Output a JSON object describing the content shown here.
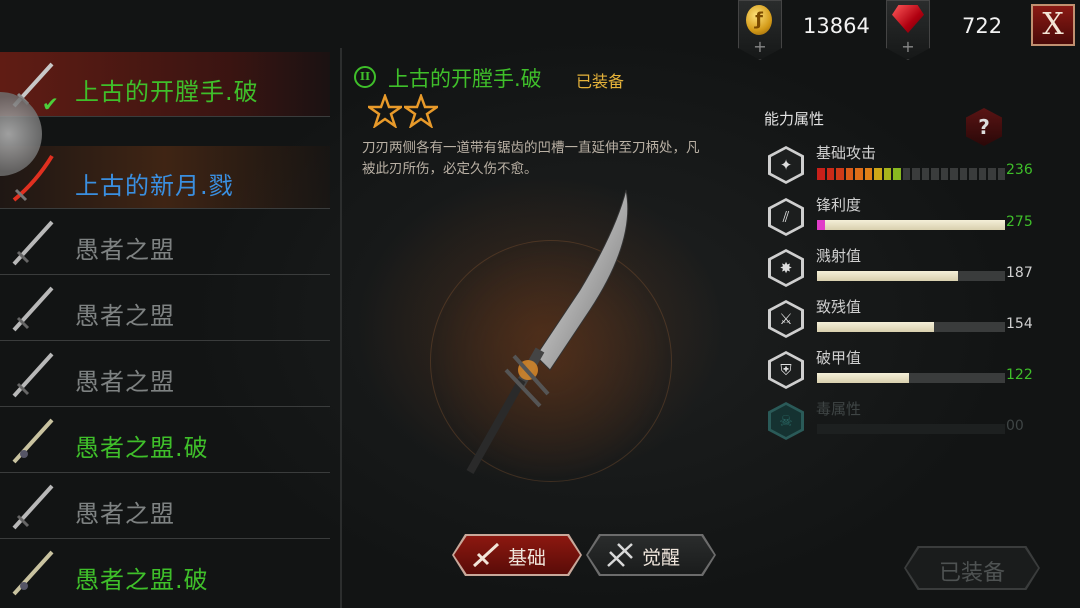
{
  "currency": {
    "gold_amount": "13864",
    "gem_amount": "722",
    "gold_icon": "gold-coin-icon",
    "gem_icon": "ruby-gem-icon",
    "plus_symbol": "+"
  },
  "close_label": "X",
  "weapon_list": [
    {
      "name": "上古的开膛手.破",
      "color": "#3fbf2a",
      "selected": true,
      "equipped": true
    },
    {
      "name": "上古的新月.戮",
      "color": "#3a8fe0"
    },
    {
      "name": "愚者之盟",
      "color": "#7e8282"
    },
    {
      "name": "愚者之盟",
      "color": "#7e8282"
    },
    {
      "name": "愚者之盟",
      "color": "#7e8282"
    },
    {
      "name": "愚者之盟.破",
      "color": "#3fbf2a"
    },
    {
      "name": "愚者之盟",
      "color": "#7e8282"
    },
    {
      "name": "愚者之盟.破",
      "color": "#3fbf2a"
    }
  ],
  "detail": {
    "tier": "II",
    "title": "上古的开膛手.破",
    "equipped_tag": "已装备",
    "stars": 2,
    "description": "刀刃两侧各有一道带有锯齿的凹槽一直延伸至刀柄处，凡被此刃所伤，必定久伤不愈。"
  },
  "attributes": {
    "title": "能力属性",
    "help_label": "?",
    "stats": [
      {
        "name": "基础攻击",
        "value": "236",
        "fraction": 0.47,
        "style": "segmented",
        "value_color": "#3fbf2a",
        "icon": "sword-emblem-icon",
        "glyph": "✦"
      },
      {
        "name": "锋利度",
        "value": "275",
        "fraction": 1.0,
        "style": "bar",
        "value_color": "#3fbf2a",
        "icon": "blade-slash-icon",
        "glyph": "⫽"
      },
      {
        "name": "溅射值",
        "value": "187",
        "fraction": 0.75,
        "style": "bar",
        "value_color": "#cfcfcf",
        "icon": "splash-icon",
        "glyph": "✸"
      },
      {
        "name": "致残值",
        "value": "154",
        "fraction": 0.62,
        "style": "bar",
        "value_color": "#cfcfcf",
        "icon": "cripple-icon",
        "glyph": "⚔"
      },
      {
        "name": "破甲值",
        "value": "122",
        "fraction": 0.49,
        "style": "bar",
        "value_color": "#3fbf2a",
        "icon": "armor-break-icon",
        "glyph": "⛨"
      },
      {
        "name": "毒属性",
        "value": "00",
        "fraction": 0,
        "style": "bar",
        "value_color": "#3f4545",
        "icon": "poison-skull-icon",
        "glyph": "☠",
        "dim": true
      }
    ]
  },
  "tabs": [
    {
      "label": "基础",
      "active": true,
      "icon": "slash-icon"
    },
    {
      "label": "觉醒",
      "active": false,
      "icon": "awaken-icon"
    }
  ],
  "equipped_button_label": "已装备"
}
